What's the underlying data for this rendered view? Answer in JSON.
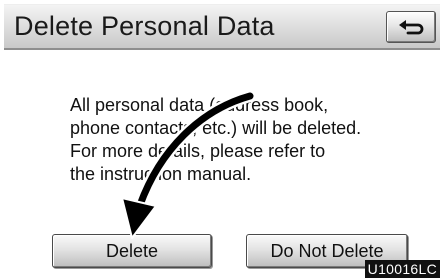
{
  "header": {
    "title": "Delete Personal Data",
    "back_icon": "return-arrow-icon"
  },
  "message": {
    "lines": [
      "All personal data (address book,",
      "phone contacts, etc.) will be deleted.",
      "For more details, please refer to",
      "the instruction manual."
    ]
  },
  "buttons": {
    "delete_label": "Delete",
    "do_not_delete_label": "Do Not Delete"
  },
  "annotation": {
    "arrow_icon": "pointer-arrow",
    "figure_code": "U10016LC"
  },
  "colors": {
    "header_bg": "#dcdcdc",
    "button_bg": "#e3e3e3",
    "arrow": "#000000"
  }
}
